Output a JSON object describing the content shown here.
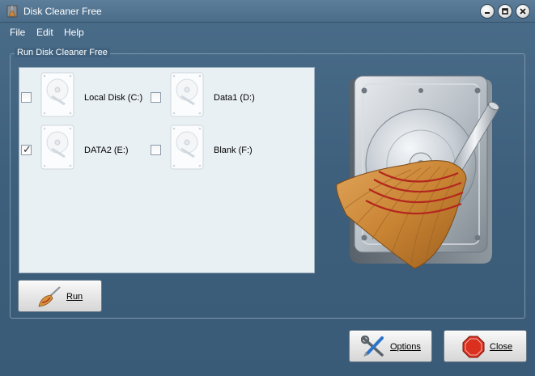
{
  "window": {
    "title": "Disk Cleaner Free"
  },
  "menu": {
    "items": [
      "File",
      "Edit",
      "Help"
    ]
  },
  "group": {
    "legend": "Run Disk Cleaner Free"
  },
  "drives": [
    {
      "label": "Local Disk (C:)",
      "checked": false
    },
    {
      "label": "Data1 (D:)",
      "checked": false
    },
    {
      "label": "DATA2 (E:)",
      "checked": true
    },
    {
      "label": "Blank (F:)",
      "checked": false
    }
  ],
  "buttons": {
    "run": "Run",
    "options": "Options",
    "close": "Close"
  },
  "colors": {
    "background": "#3f5f7a",
    "panel": "#e9f0f3",
    "close_stop": "#d9301f"
  }
}
